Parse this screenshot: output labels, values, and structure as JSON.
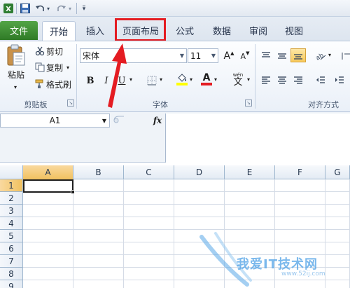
{
  "qat": {
    "save": "save-icon",
    "undo_arrow": "▾",
    "redo_arrow": "▾",
    "customize": "▾"
  },
  "tabs": [
    {
      "label": "文件"
    },
    {
      "label": "开始"
    },
    {
      "label": "插入"
    },
    {
      "label": "页面布局"
    },
    {
      "label": "公式"
    },
    {
      "label": "数据"
    },
    {
      "label": "审阅"
    },
    {
      "label": "视图"
    }
  ],
  "clipboard": {
    "paste": "粘贴",
    "cut": "剪切",
    "copy": "复制",
    "format_painter": "格式刷",
    "group_label": "剪贴板"
  },
  "font": {
    "name": "宋体",
    "size": "11",
    "grow": "A",
    "shrink": "A",
    "bold": "B",
    "italic": "I",
    "underline": "U",
    "font_color_letter": "A",
    "phonetic_top": "wén",
    "phonetic_char": "文",
    "group_label": "字体"
  },
  "alignment": {
    "group_label": "对齐方式"
  },
  "formula_bar": {
    "name_box": "A1",
    "fx": "fx"
  },
  "grid": {
    "columns": [
      "A",
      "B",
      "C",
      "D",
      "E",
      "F",
      "G"
    ],
    "rows": [
      "1",
      "2",
      "3",
      "4",
      "5",
      "6",
      "7",
      "8",
      "9"
    ],
    "active_column": "A",
    "active_row": "1"
  },
  "watermark": {
    "text": "我爱IT技术网",
    "url": "www.52ij.com"
  },
  "colors": {
    "file_tab": "#3f9133",
    "highlight_box": "#e41c22",
    "arrow": "#e41c22",
    "selected_header": "#f5c96d",
    "font_color_bar": "#e41c22",
    "fill_color_bar": "#ffff00"
  }
}
